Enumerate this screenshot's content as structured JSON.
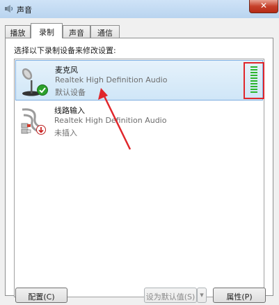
{
  "window": {
    "title": "声音"
  },
  "tabs": [
    {
      "label": "播放"
    },
    {
      "label": "录制"
    },
    {
      "label": "声音"
    },
    {
      "label": "通信"
    }
  ],
  "active_tab": "录制",
  "instruction": "选择以下录制设备来修改设置:",
  "devices": [
    {
      "name": "麦克风",
      "driver": "Realtek High Definition Audio",
      "status": "默认设备",
      "icon": "microphone-icon",
      "badge": "green-check-icon",
      "selected": true
    },
    {
      "name": "线路输入",
      "driver": "Realtek High Definition Audio",
      "status": "未插入",
      "icon": "line-in-cable-icon",
      "badge": "red-down-arrow-icon",
      "selected": false
    }
  ],
  "level_meter": {
    "level": 1.0,
    "segments": 10,
    "color": "#2db52d"
  },
  "buttons": {
    "configure": "配置(C)",
    "set_default": "设为默认值(S)",
    "properties": "属性(P)"
  },
  "annotation": {
    "highlight_color": "#e0262b"
  }
}
